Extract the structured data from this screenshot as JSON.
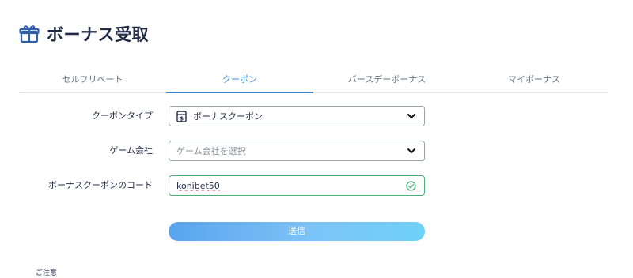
{
  "header": {
    "title": "ボーナス受取",
    "icon": "gift-icon"
  },
  "tabs": [
    {
      "label": "セルフリベート",
      "active": false
    },
    {
      "label": "クーポン",
      "active": true
    },
    {
      "label": "バースデーボーナス",
      "active": false
    },
    {
      "label": "マイボーナス",
      "active": false
    }
  ],
  "form": {
    "coupon_type": {
      "label": "クーポンタイプ",
      "value": "ボーナスクーポン",
      "icon": "coupon-icon"
    },
    "game_company": {
      "label": "ゲーム会社",
      "placeholder": "ゲーム会社を選択"
    },
    "coupon_code": {
      "label": "ボーナスクーポンのコード",
      "value": "konibet50",
      "status": "valid"
    },
    "submit_label": "送信"
  },
  "notice": {
    "label": "ご注意"
  },
  "colors": {
    "accent": "#3d8bd9",
    "title": "#1f2a44",
    "valid": "#4caf7a",
    "button_gradient_start": "#5aa4ef",
    "button_gradient_end": "#6fd2f8"
  }
}
